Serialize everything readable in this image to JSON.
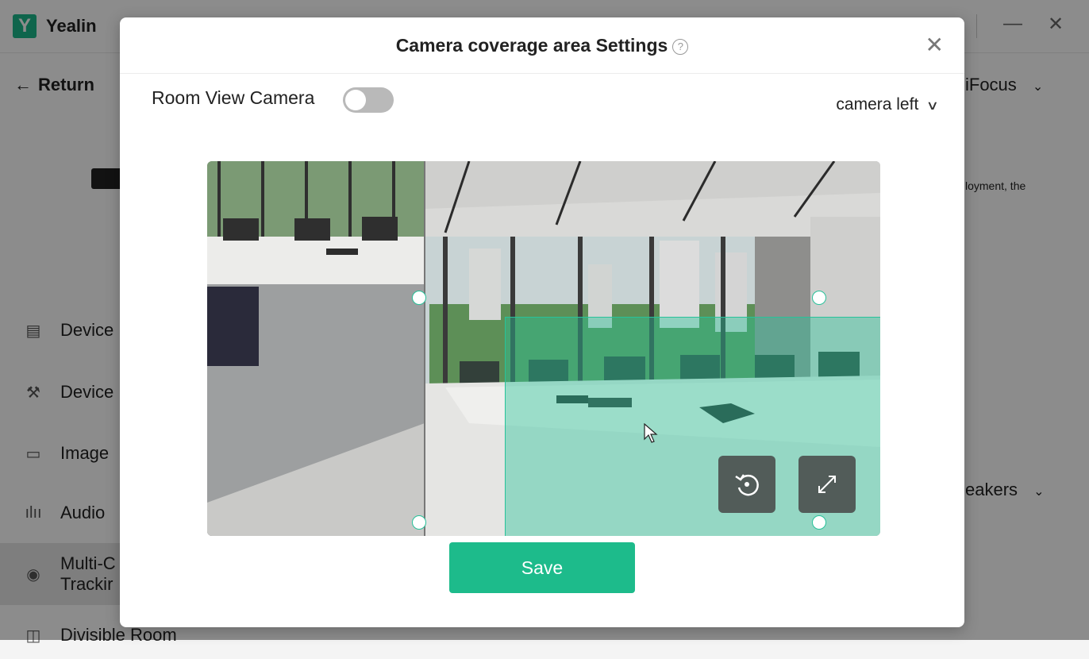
{
  "app": {
    "title": "Yealin",
    "logo_letter": "Y",
    "return_label": "Return",
    "nav": [
      {
        "icon": "document-icon",
        "label": "Device"
      },
      {
        "icon": "wrench-icon",
        "label": "Device"
      },
      {
        "icon": "camera-icon",
        "label": "Image"
      },
      {
        "icon": "audio-icon",
        "label": "Audio"
      },
      {
        "icon": "eye-icon",
        "label_line1": "Multi-C",
        "label_line2": "Trackir"
      },
      {
        "icon": "divisible-icon",
        "label": "Divisible Room"
      }
    ],
    "right_label_top": "iFocus",
    "right_text": "loyment, the",
    "right_label_bottom": "eakers"
  },
  "dialog": {
    "title": "Camera coverage area Settings",
    "room_view_label": "Room View Camera",
    "room_view_enabled": false,
    "camera_select": "camera left",
    "save_label": "Save"
  },
  "colors": {
    "accent": "#1dbb8b",
    "coverage_fill": "#26c498"
  }
}
